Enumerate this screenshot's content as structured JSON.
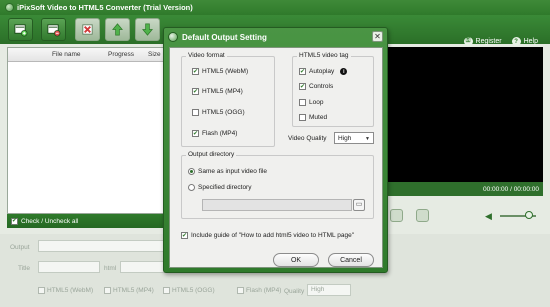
{
  "window": {
    "title": "iPixSoft Video to HTML5 Converter (Trial Version)"
  },
  "toolbar": {
    "buttons": [
      "add-video-icon",
      "add-folder-icon",
      "delete-icon",
      "move-up-icon",
      "move-down-icon",
      "settings-icon"
    ],
    "register_label": "Register",
    "help_label": "Help"
  },
  "file_list": {
    "columns": [
      "File name",
      "Progress",
      "Size"
    ],
    "check_all_label": "Check / Uncheck all",
    "check_all_checked": true
  },
  "preview": {
    "time": "00:00:00 / 00:00:00"
  },
  "bottom": {
    "output_label": "Output",
    "title_label": "Title",
    "html_label": "html",
    "formats": [
      "HTML5 (WebM)",
      "HTML5 (MP4)",
      "HTML5 (OGG)",
      "Flash (MP4)"
    ],
    "quality_label": "Quality",
    "quality_value": "High"
  },
  "dialog": {
    "title": "Default Output Setting",
    "close_glyph": "✕",
    "video_format": {
      "title": "Video format",
      "options": [
        {
          "label": "HTML5 (WebM)",
          "checked": true
        },
        {
          "label": "HTML5 (MP4)",
          "checked": true
        },
        {
          "label": "HTML5 (OGG)",
          "checked": false
        },
        {
          "label": "Flash (MP4)",
          "checked": true
        }
      ]
    },
    "html5_tag": {
      "title": "HTML5 video tag",
      "options": [
        {
          "label": "Autoplay",
          "checked": true
        },
        {
          "label": "Controls",
          "checked": true
        },
        {
          "label": "Loop",
          "checked": false
        },
        {
          "label": "Muted",
          "checked": false
        }
      ],
      "info_glyph": "i"
    },
    "video_quality": {
      "label": "Video Quality",
      "value": "High"
    },
    "output_directory": {
      "title": "Output directory",
      "options": [
        {
          "label": "Same as input video file",
          "selected": true
        },
        {
          "label": "Specified directory",
          "selected": false
        }
      ],
      "path": ""
    },
    "include_guide": {
      "label": "Include guide of \"How to add html5 video to HTML page\"",
      "checked": true
    },
    "ok_label": "OK",
    "cancel_label": "Cancel"
  }
}
